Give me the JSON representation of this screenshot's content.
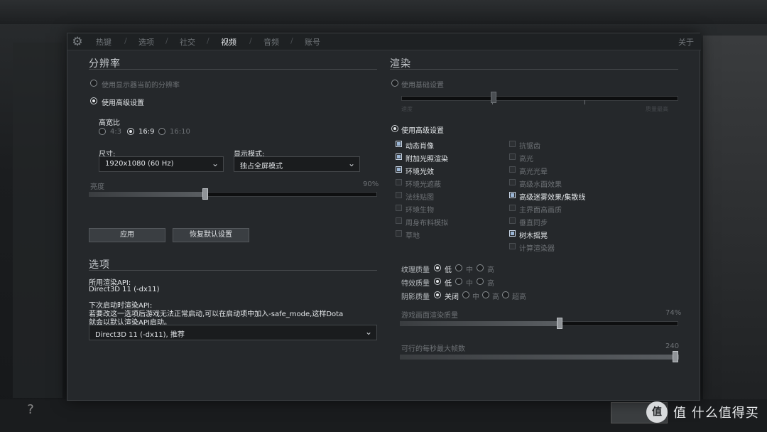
{
  "tabs": [
    {
      "label": "热键",
      "active": false
    },
    {
      "label": "选项",
      "active": false
    },
    {
      "label": "社交",
      "active": false
    },
    {
      "label": "视频",
      "active": true
    },
    {
      "label": "音频",
      "active": false
    },
    {
      "label": "账号",
      "active": false
    }
  ],
  "tab_separator": "/",
  "about_label": "关于",
  "resolution": {
    "title": "分辨率",
    "use_display_current": "使用显示器当前的分辨率",
    "use_advanced": "使用高级设置",
    "aspect_label": "高宽比",
    "aspect_options": [
      "4:3",
      "16:9",
      "16:10"
    ],
    "aspect_selected": "16:9",
    "size_label": "尺寸:",
    "size_value": "1920x1080 (60 Hz)",
    "display_mode_label": "显示模式:",
    "display_mode_value": "独占全屏模式",
    "brightness_label": "亮度",
    "brightness_value": "90%",
    "brightness_fraction": 0.4,
    "apply_button": "应用",
    "reset_button": "恢复默认设置"
  },
  "options": {
    "title": "选项",
    "render_api_label": "所用渲染API:",
    "render_api_value": "Direct3D 11 (-dx11)",
    "next_launch_label": "下次启动时渲染API:",
    "hint_line1": "若要改这一选项后游戏无法正常启动,可以在启动项中加入-safe_mode,这样Dota",
    "hint_line2": "就会以默认渲染API启动。",
    "api_select_value": "Direct3D 11 (-dx11), 推荐"
  },
  "render": {
    "title": "渲染",
    "use_basic": "使用基础设置",
    "basic_left_label": "速度",
    "basic_right_label": "质量最高",
    "use_advanced": "使用高级设置",
    "left_checks": [
      {
        "label": "动态肖像",
        "on": true
      },
      {
        "label": "附加光照渲染",
        "on": true
      },
      {
        "label": "环境光效",
        "on": true
      },
      {
        "label": "环境光遮蔽",
        "on": false
      },
      {
        "label": "法线贴图",
        "on": false
      },
      {
        "label": "环境生物",
        "on": false
      },
      {
        "label": "周身布料模拟",
        "on": false
      },
      {
        "label": "草地",
        "on": false
      }
    ],
    "right_checks": [
      {
        "label": "抗锯齿",
        "on": false
      },
      {
        "label": "高光",
        "on": false
      },
      {
        "label": "高光光晕",
        "on": false
      },
      {
        "label": "高级水面效果",
        "on": false
      },
      {
        "label": "高级迷雾效果/集散线",
        "on": true
      },
      {
        "label": "主界面高画质",
        "on": false
      },
      {
        "label": "垂直同步",
        "on": false
      },
      {
        "label": "树木摇晃",
        "on": true
      },
      {
        "label": "计算渲染器",
        "on": false
      }
    ],
    "texture_quality": {
      "label": "纹理质量",
      "options": [
        "低",
        "中",
        "高"
      ],
      "selected": "低"
    },
    "effects_quality": {
      "label": "特效质量",
      "options": [
        "低",
        "中",
        "高"
      ],
      "selected": "低"
    },
    "shadow_quality": {
      "label": "阴影质量",
      "options": [
        "关闭",
        "中",
        "高",
        "超高"
      ],
      "selected": "关闭"
    },
    "render_quality_label": "游戏画面渲染质量",
    "render_quality_value": "74%",
    "render_quality_fraction": 0.57,
    "max_fps_label": "可行的每秒最大帧数",
    "max_fps_value": "240",
    "max_fps_fraction": 1.0
  },
  "watermark": "值 什么值得买",
  "colors": {
    "panel_bg": "#25282b",
    "accent_check": "#9bb6d6"
  }
}
